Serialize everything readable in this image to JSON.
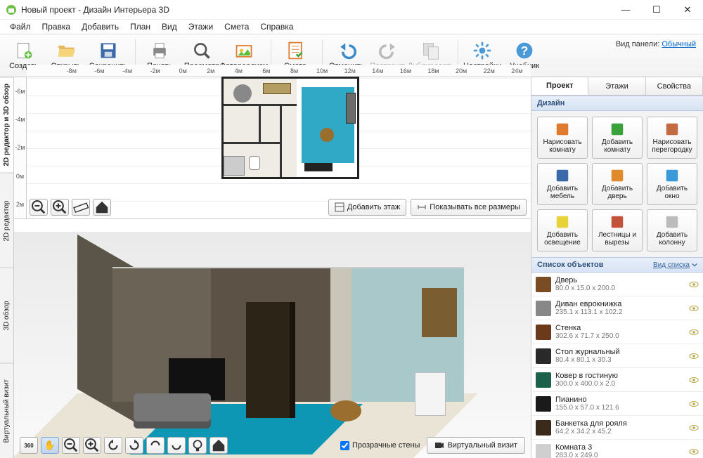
{
  "window": {
    "title": "Новый проект - Дизайн Интерьера 3D"
  },
  "menu": [
    "Файл",
    "Правка",
    "Добавить",
    "План",
    "Вид",
    "Этажи",
    "Смета",
    "Справка"
  ],
  "toolbar": [
    {
      "label": "Создать",
      "icon": "new"
    },
    {
      "label": "Открыть",
      "icon": "open"
    },
    {
      "label": "Сохранить",
      "icon": "save"
    },
    {
      "_sep": true
    },
    {
      "label": "Печать",
      "icon": "print"
    },
    {
      "label": "Просмотр",
      "icon": "preview"
    },
    {
      "label": "Фотореализм",
      "icon": "photoreal"
    },
    {
      "_sep": true
    },
    {
      "label": "Смета",
      "icon": "estimate"
    },
    {
      "_sep": true
    },
    {
      "label": "Отменить",
      "icon": "undo"
    },
    {
      "label": "Повторить",
      "icon": "redo",
      "disabled": true
    },
    {
      "label": "Дублировать",
      "icon": "duplicate",
      "disabled": true
    },
    {
      "_sep": true
    },
    {
      "label": "Настройки",
      "icon": "settings"
    },
    {
      "label": "Учебник",
      "icon": "help"
    }
  ],
  "panel_mode": {
    "label": "Вид панели:",
    "value": "Обычный"
  },
  "vtabs": [
    "2D редактор и 3D обзор",
    "2D редактор",
    "3D обзор",
    "Виртуальный визит"
  ],
  "ruler_h": [
    "-8м",
    "-6м",
    "-4м",
    "-2м",
    "0м",
    "2м",
    "4м",
    "6м",
    "8м",
    "10м",
    "12м",
    "14м",
    "16м",
    "18м",
    "20м",
    "22м",
    "24м"
  ],
  "ruler_v": [
    "-6м",
    "-4м",
    "-2м",
    "0м",
    "2м"
  ],
  "plan_btns": {
    "add_floor": "Добавить этаж",
    "show_dims": "Показывать все размеры"
  },
  "bottom": {
    "transparent_walls": "Прозрачные стены",
    "virtual_visit": "Виртуальный визит"
  },
  "right": {
    "tabs": [
      "Проект",
      "Этажи",
      "Свойства"
    ],
    "design_label": "Дизайн",
    "design_btns": [
      {
        "t1": "Нарисовать",
        "t2": "комнату",
        "icon": "#e07a2c"
      },
      {
        "t1": "Добавить",
        "t2": "комнату",
        "icon": "#3aa23a"
      },
      {
        "t1": "Нарисовать",
        "t2": "перегородку",
        "icon": "#c26a42"
      },
      {
        "t1": "Добавить",
        "t2": "мебель",
        "icon": "#3a6aaa"
      },
      {
        "t1": "Добавить",
        "t2": "дверь",
        "icon": "#e08a2c"
      },
      {
        "t1": "Добавить",
        "t2": "окно",
        "icon": "#3a9ad8"
      },
      {
        "t1": "Добавить",
        "t2": "освещение",
        "icon": "#e8d23a"
      },
      {
        "t1": "Лестницы и",
        "t2": "вырезы",
        "icon": "#c2523a"
      },
      {
        "t1": "Добавить",
        "t2": "колонну",
        "icon": "#bcbcbc"
      }
    ],
    "objects_label": "Список объектов",
    "view_list_label": "Вид списка",
    "objects": [
      {
        "name": "Дверь",
        "dims": "80.0 x 15.0 x 200.0",
        "c": "#7a4c24"
      },
      {
        "name": "Диван еврокнижка",
        "dims": "235.1 x 113.1 x 102.2",
        "c": "#888"
      },
      {
        "name": "Стенка",
        "dims": "302.6 x 71.7 x 250.0",
        "c": "#6a3a1a"
      },
      {
        "name": "Стол журнальный",
        "dims": "80.4 x 80.1 x 30.3",
        "c": "#2a2a2a"
      },
      {
        "name": "Ковер в гостиную",
        "dims": "300.0 x 400.0 x 2.0",
        "c": "#1a604a"
      },
      {
        "name": "Пианино",
        "dims": "155.0 x 57.0 x 121.6",
        "c": "#1a1a1a"
      },
      {
        "name": "Банкетка для рояля",
        "dims": "64.2 x 34.2 x 45.2",
        "c": "#3a2a1a"
      },
      {
        "name": "Комната 3",
        "dims": "283.0 x 249.0",
        "c": "#cfcfcf"
      }
    ]
  }
}
